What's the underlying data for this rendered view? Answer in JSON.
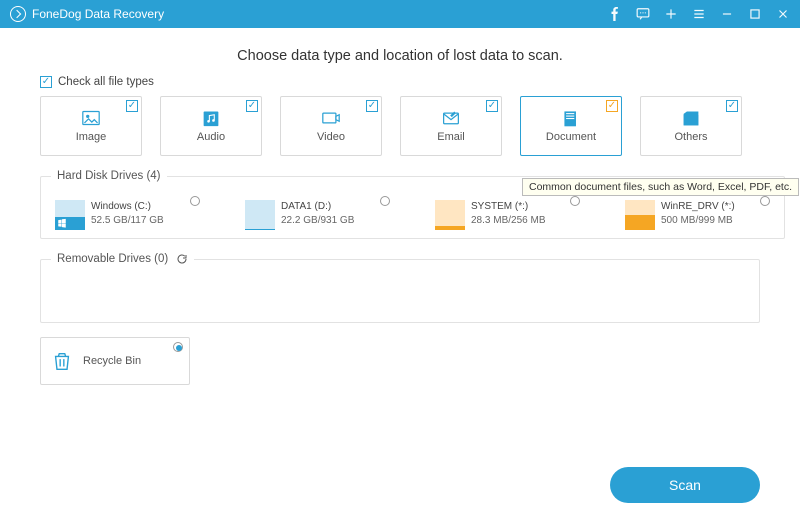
{
  "titlebar": {
    "title": "FoneDog Data Recovery"
  },
  "heading": "Choose data type and location of lost data to scan.",
  "check_all": {
    "label": "Check all file types",
    "checked": true
  },
  "types": [
    {
      "key": "image",
      "label": "Image",
      "checked": true,
      "active": false,
      "color": "blue"
    },
    {
      "key": "audio",
      "label": "Audio",
      "checked": true,
      "active": false,
      "color": "blue"
    },
    {
      "key": "video",
      "label": "Video",
      "checked": true,
      "active": false,
      "color": "blue"
    },
    {
      "key": "email",
      "label": "Email",
      "checked": true,
      "active": false,
      "color": "blue"
    },
    {
      "key": "document",
      "label": "Document",
      "checked": true,
      "active": true,
      "color": "orange"
    },
    {
      "key": "others",
      "label": "Others",
      "checked": true,
      "active": false,
      "color": "blue"
    }
  ],
  "tooltip": "Common document files, such as Word, Excel, PDF, etc.",
  "hard_disk": {
    "legend": "Hard Disk Drives (4)",
    "drives": [
      {
        "name": "Windows (C:)",
        "size": "52.5 GB/117 GB",
        "fill_pct": 45,
        "style": "blue",
        "win": true
      },
      {
        "name": "DATA1 (D:)",
        "size": "22.2 GB/931 GB",
        "fill_pct": 5,
        "style": "blue",
        "win": false
      },
      {
        "name": "SYSTEM (*:)",
        "size": "28.3 MB/256 MB",
        "fill_pct": 12,
        "style": "orange",
        "win": false
      },
      {
        "name": "WinRE_DRV (*:)",
        "size": "500 MB/999 MB",
        "fill_pct": 50,
        "style": "orange",
        "win": false
      }
    ]
  },
  "removable": {
    "legend": "Removable Drives (0)"
  },
  "recycle": {
    "label": "Recycle Bin",
    "selected": true
  },
  "scan_label": "Scan"
}
